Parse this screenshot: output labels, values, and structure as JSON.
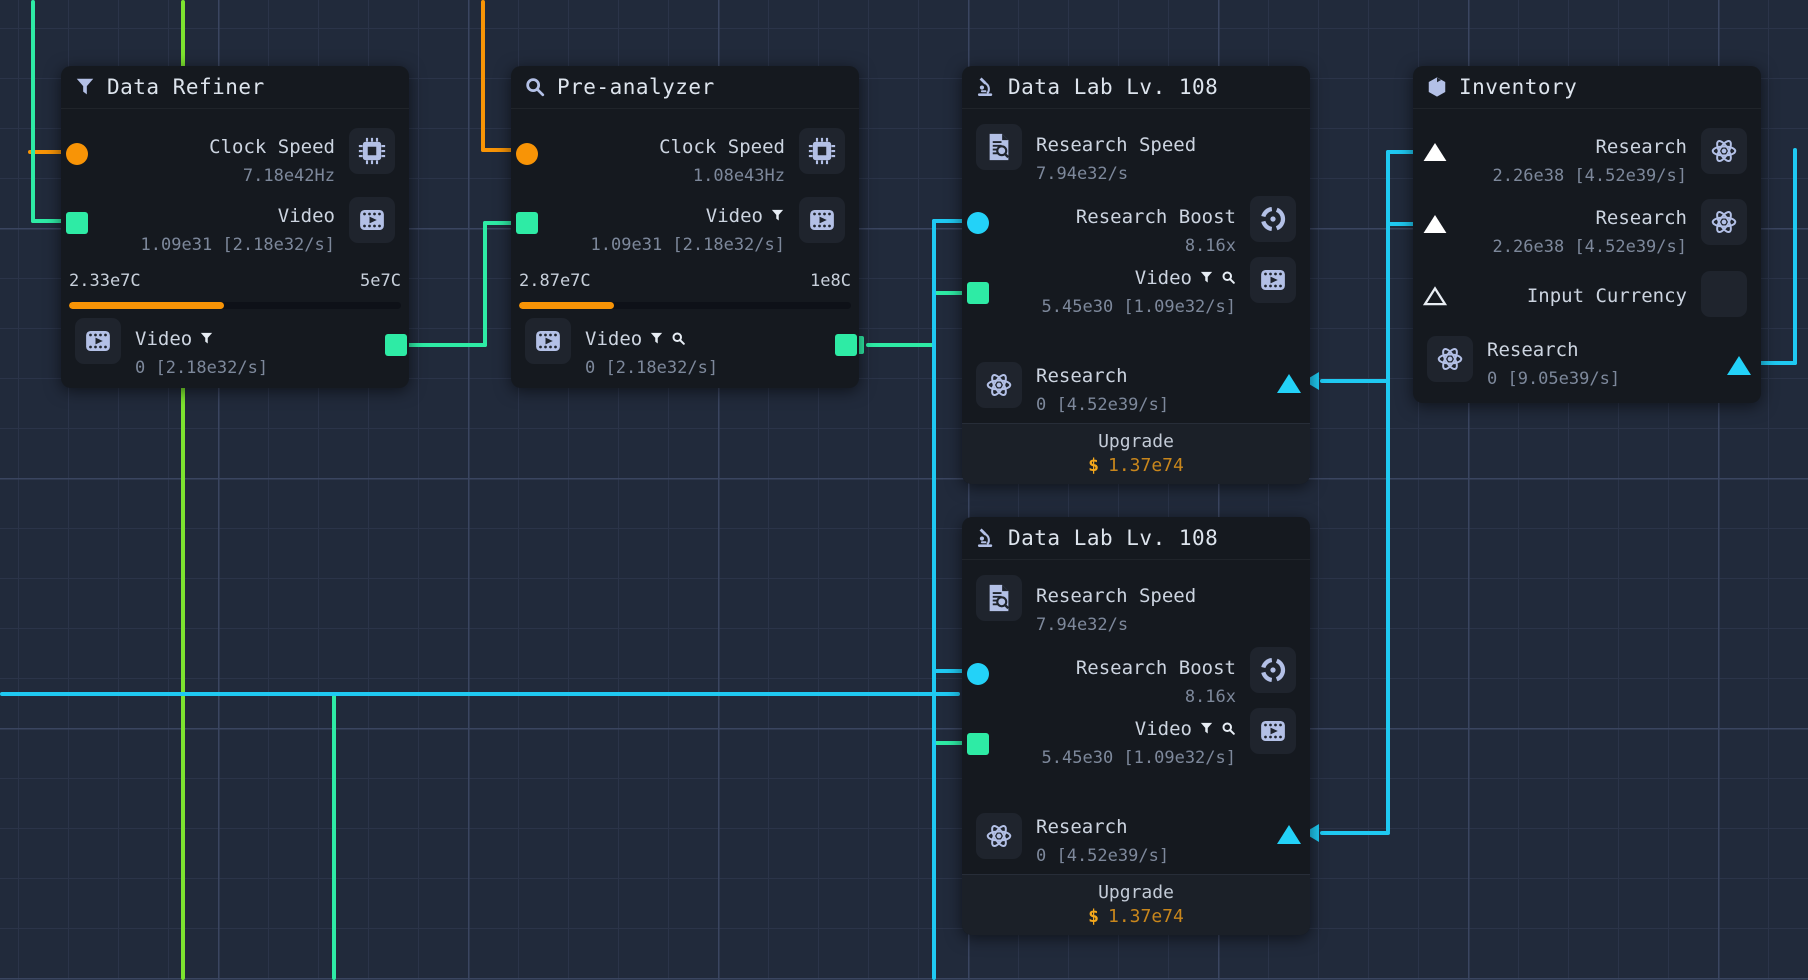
{
  "palette": {
    "orange": "#f89406",
    "lime": "#7de32f",
    "green": "#2eeba5",
    "cyan": "#1fc9f2",
    "icon": "#b3c0e6",
    "card_bg": "#15191f",
    "canvas_bg": "#212a3b"
  },
  "cards": {
    "refiner": {
      "title": "Data Refiner",
      "clock": {
        "label": "Clock Speed",
        "value": "7.18e42Hz"
      },
      "video_in": {
        "label": "Video",
        "value": "1.09e31 [2.18e32/s]"
      },
      "progress": {
        "current": "2.33e7C",
        "max": "5e7C",
        "fraction": 0.466
      },
      "video_out": {
        "label": "Video",
        "value": "0 [2.18e32/s]"
      }
    },
    "preanalyzer": {
      "title": "Pre-analyzer",
      "clock": {
        "label": "Clock Speed",
        "value": "1.08e43Hz"
      },
      "video_in": {
        "label": "Video",
        "value": "1.09e31 [2.18e32/s]"
      },
      "progress": {
        "current": "2.87e7C",
        "max": "1e8C",
        "fraction": 0.287
      },
      "video_out": {
        "label": "Video",
        "value": "0 [2.18e32/s]"
      }
    },
    "lab1": {
      "title": "Data Lab Lv. 108",
      "speed": {
        "label": "Research Speed",
        "value": "7.94e32/s"
      },
      "boost": {
        "label": "Research Boost",
        "value": "8.16x"
      },
      "video": {
        "label": "Video",
        "value": "5.45e30 [1.09e32/s]"
      },
      "research": {
        "label": "Research",
        "value": "0 [4.52e39/s]"
      },
      "upgrade": {
        "label": "Upgrade",
        "currency": "$",
        "cost": "1.37e74"
      }
    },
    "lab2": {
      "title": "Data Lab Lv. 108",
      "speed": {
        "label": "Research Speed",
        "value": "7.94e32/s"
      },
      "boost": {
        "label": "Research Boost",
        "value": "8.16x"
      },
      "video": {
        "label": "Video",
        "value": "5.45e30 [1.09e32/s]"
      },
      "research": {
        "label": "Research",
        "value": "0 [4.52e39/s]"
      },
      "upgrade": {
        "label": "Upgrade",
        "currency": "$",
        "cost": "1.37e74"
      }
    },
    "inventory": {
      "title": "Inventory",
      "research1": {
        "label": "Research",
        "value": "2.26e38 [4.52e39/s]"
      },
      "research2": {
        "label": "Research",
        "value": "2.26e38 [4.52e39/s]"
      },
      "input_currency": {
        "label": "Input Currency"
      },
      "research_out": {
        "label": "Research",
        "value": "0 [9.05e39/s]"
      }
    }
  }
}
